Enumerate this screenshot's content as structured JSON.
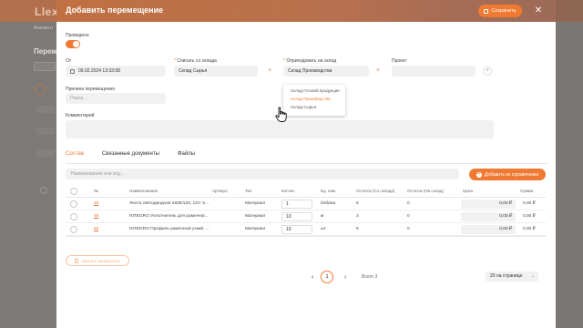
{
  "background": {
    "logo": "Llex",
    "breadcrumb": "Анализ п",
    "title": "Перем"
  },
  "modal": {
    "title": "Добавить перемещение",
    "save_label": "Сохранить",
    "close_icon": "close-icon"
  },
  "form": {
    "posted_label": "Проведено",
    "posted": true,
    "from_label": "От",
    "date_value": "09.02.2024 13:33:58",
    "write_off_label": "Списать со склада",
    "write_off_value": "Склад Сырья",
    "receive_label": "Оприходовать на склад",
    "receive_value": "Склад Производства",
    "project_label": "Проект",
    "reason_label": "Причина перемещения",
    "reason_placeholder": "Поиск...",
    "comment_label": "Комментарий",
    "required_mark": "*"
  },
  "dropdown": {
    "options": [
      "Склад Готовой продукции",
      "Склад Производства",
      "Склад Сырья"
    ],
    "active_index": 1
  },
  "tabs": [
    {
      "label": "Состав",
      "active": true
    },
    {
      "label": "Связанные документы",
      "active": false
    },
    {
      "label": "Файлы",
      "active": false
    }
  ],
  "toolbar": {
    "search_placeholder": "Наименование или код...",
    "add_label": "Добавить из справочника"
  },
  "table": {
    "headers": [
      "№",
      "Наименование",
      "Артикул",
      "Тип",
      "Кол-во",
      "Ед. изм.",
      "Остаток (Со склада)",
      "Остаток (На склад)",
      "Цена",
      "Сумма"
    ],
    "rows": [
      {
        "num": "46",
        "name": "Лента светодиодная 2835/120, 12V, 5...",
        "article": "",
        "type": "Материал",
        "qty": "1",
        "unit": "бобина",
        "stock_from": "5",
        "stock_to": "0",
        "price": "0,00 ₽",
        "sum": "0,00 ₽"
      },
      {
        "num": "48",
        "name": "INTEGRO Уплотнитель для рамочног...",
        "article": "",
        "type": "Материал",
        "qty": "10",
        "unit": "м",
        "stock_from": "3",
        "stock_to": "0",
        "price": "0,00 ₽",
        "sum": "0,00 ₽"
      },
      {
        "num": "50",
        "name": "INTEGRO Профиль рамочный узкий, ...",
        "article": "",
        "type": "Материал",
        "qty": "10",
        "unit": "шт",
        "stock_from": "5",
        "stock_to": "0",
        "price": "0,00 ₽",
        "sum": "0,00 ₽"
      }
    ]
  },
  "footer": {
    "delete_label": "Удалить выбранные",
    "page": "1",
    "prev": "‹",
    "next": "›",
    "total": "Всего 3",
    "per_page": "20 на странице"
  },
  "colors": {
    "accent": "#f07a32",
    "header_gradient_start": "#c07042"
  }
}
